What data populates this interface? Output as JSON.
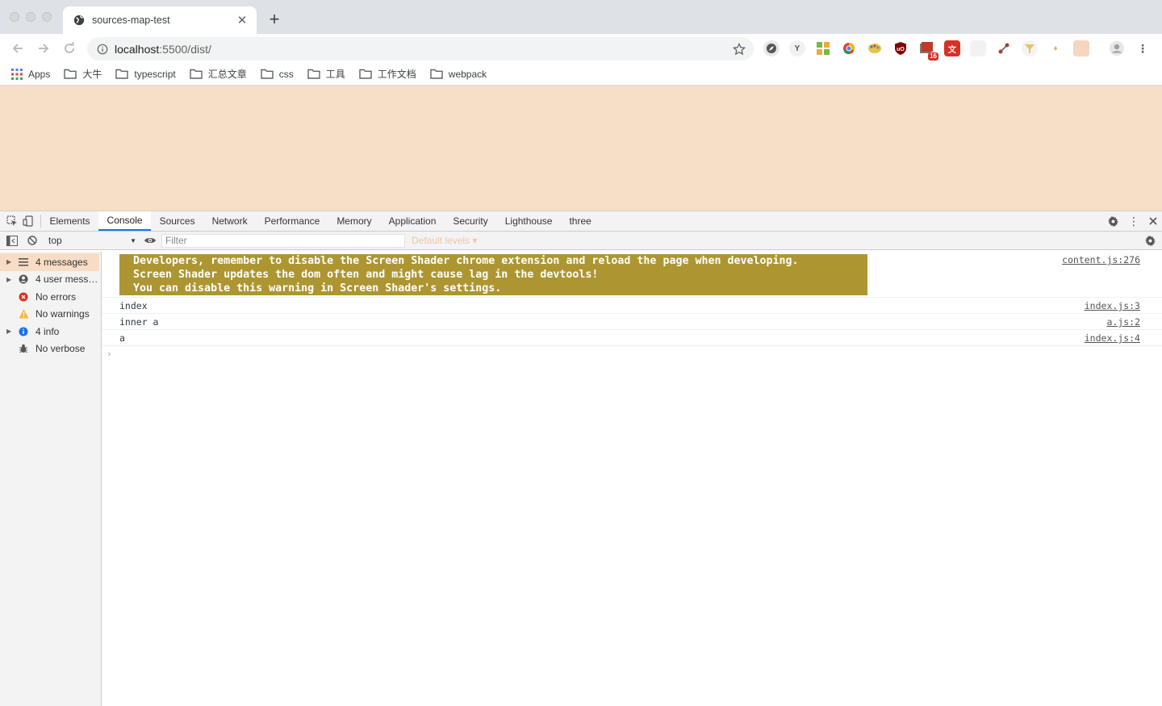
{
  "browser": {
    "tab_title": "sources-map-test",
    "url_host": "localhost",
    "url_rest": ":5500/dist/"
  },
  "bookmarks": [
    {
      "label": "Apps",
      "icon": "apps-grid-icon"
    },
    {
      "label": "大牛",
      "icon": "folder-icon"
    },
    {
      "label": "typescript",
      "icon": "folder-icon"
    },
    {
      "label": "汇总文章",
      "icon": "folder-icon"
    },
    {
      "label": "css",
      "icon": "folder-icon"
    },
    {
      "label": "工具",
      "icon": "folder-icon"
    },
    {
      "label": "工作文档",
      "icon": "folder-icon"
    },
    {
      "label": "webpack",
      "icon": "folder-icon"
    }
  ],
  "extension_badge": "16",
  "page": {
    "background": "#f7dec6"
  },
  "devtools": {
    "tabs": [
      "Elements",
      "Console",
      "Sources",
      "Network",
      "Performance",
      "Memory",
      "Application",
      "Security",
      "Lighthouse",
      "three"
    ],
    "active_tab": "Console",
    "context": "top",
    "filter_placeholder": "Filter",
    "levels_label": "Default levels ▾",
    "sidebar": [
      {
        "label": "4 messages",
        "icon": "list-icon",
        "expandable": true,
        "selected": true
      },
      {
        "label": "4 user mess…",
        "icon": "user-icon",
        "expandable": true,
        "selected": false
      },
      {
        "label": "No errors",
        "icon": "error-icon",
        "expandable": false,
        "selected": false
      },
      {
        "label": "No warnings",
        "icon": "warning-icon",
        "expandable": false,
        "selected": false
      },
      {
        "label": "4 info",
        "icon": "info-icon",
        "expandable": true,
        "selected": false
      },
      {
        "label": "No verbose",
        "icon": "bug-icon",
        "expandable": false,
        "selected": false
      }
    ],
    "messages": [
      {
        "text": "Developers, remember to disable the Screen Shader chrome extension and reload the page when developing.\nScreen Shader updates the dom often and might cause lag in the devtools!\nYou can disable this warning in Screen Shader's settings.",
        "source": "content.js:276",
        "styled": true
      },
      {
        "text": "index",
        "source": "index.js:3",
        "styled": false
      },
      {
        "text": "inner a",
        "source": "a.js:2",
        "styled": false
      },
      {
        "text": "a",
        "source": "index.js:4",
        "styled": false
      }
    ],
    "prompt_symbol": "›"
  }
}
